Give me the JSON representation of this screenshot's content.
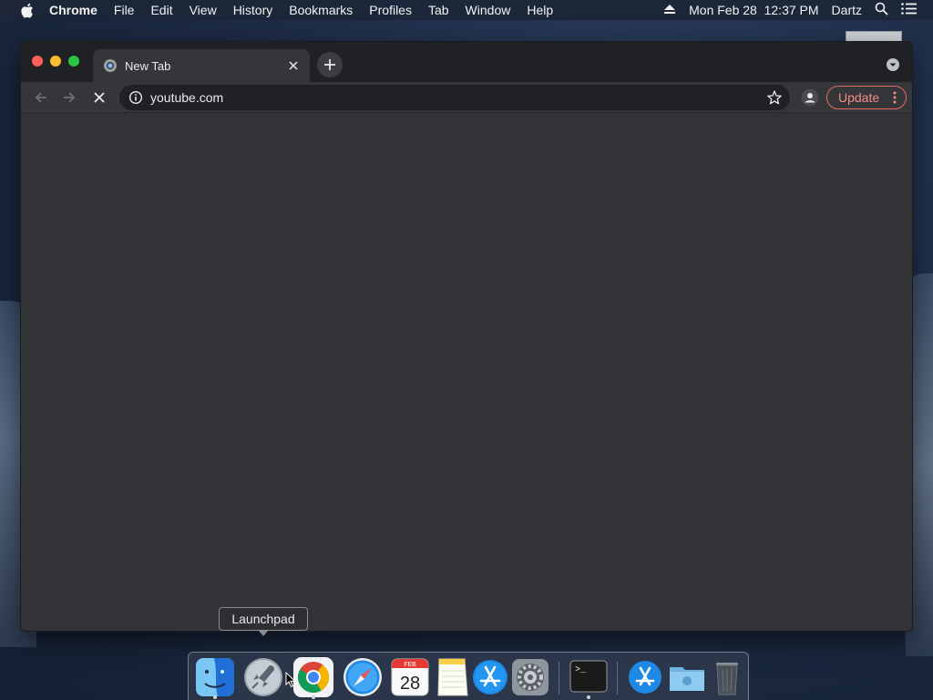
{
  "menubar": {
    "app_name": "Chrome",
    "menus": [
      "File",
      "Edit",
      "View",
      "History",
      "Bookmarks",
      "Profiles",
      "Tab",
      "Window",
      "Help"
    ],
    "datetime": "Mon Feb 28  12:37 PM",
    "user": "Dartz"
  },
  "browser": {
    "tab_title": "New Tab",
    "url": "youtube.com",
    "update_label": "Update"
  },
  "tooltip": {
    "text": "Launchpad"
  },
  "dock": {
    "items": [
      "Finder",
      "Launchpad",
      "Google Chrome",
      "Safari",
      "Calendar",
      "Notes",
      "App Store",
      "System Preferences",
      "Terminal",
      "App Store",
      "Downloads",
      "Trash"
    ],
    "calendar_month": "FEB",
    "calendar_day": "28"
  },
  "colors": {
    "accent_update": "#f28b82",
    "window_bg": "#323337",
    "tabstrip_bg": "#202124"
  }
}
